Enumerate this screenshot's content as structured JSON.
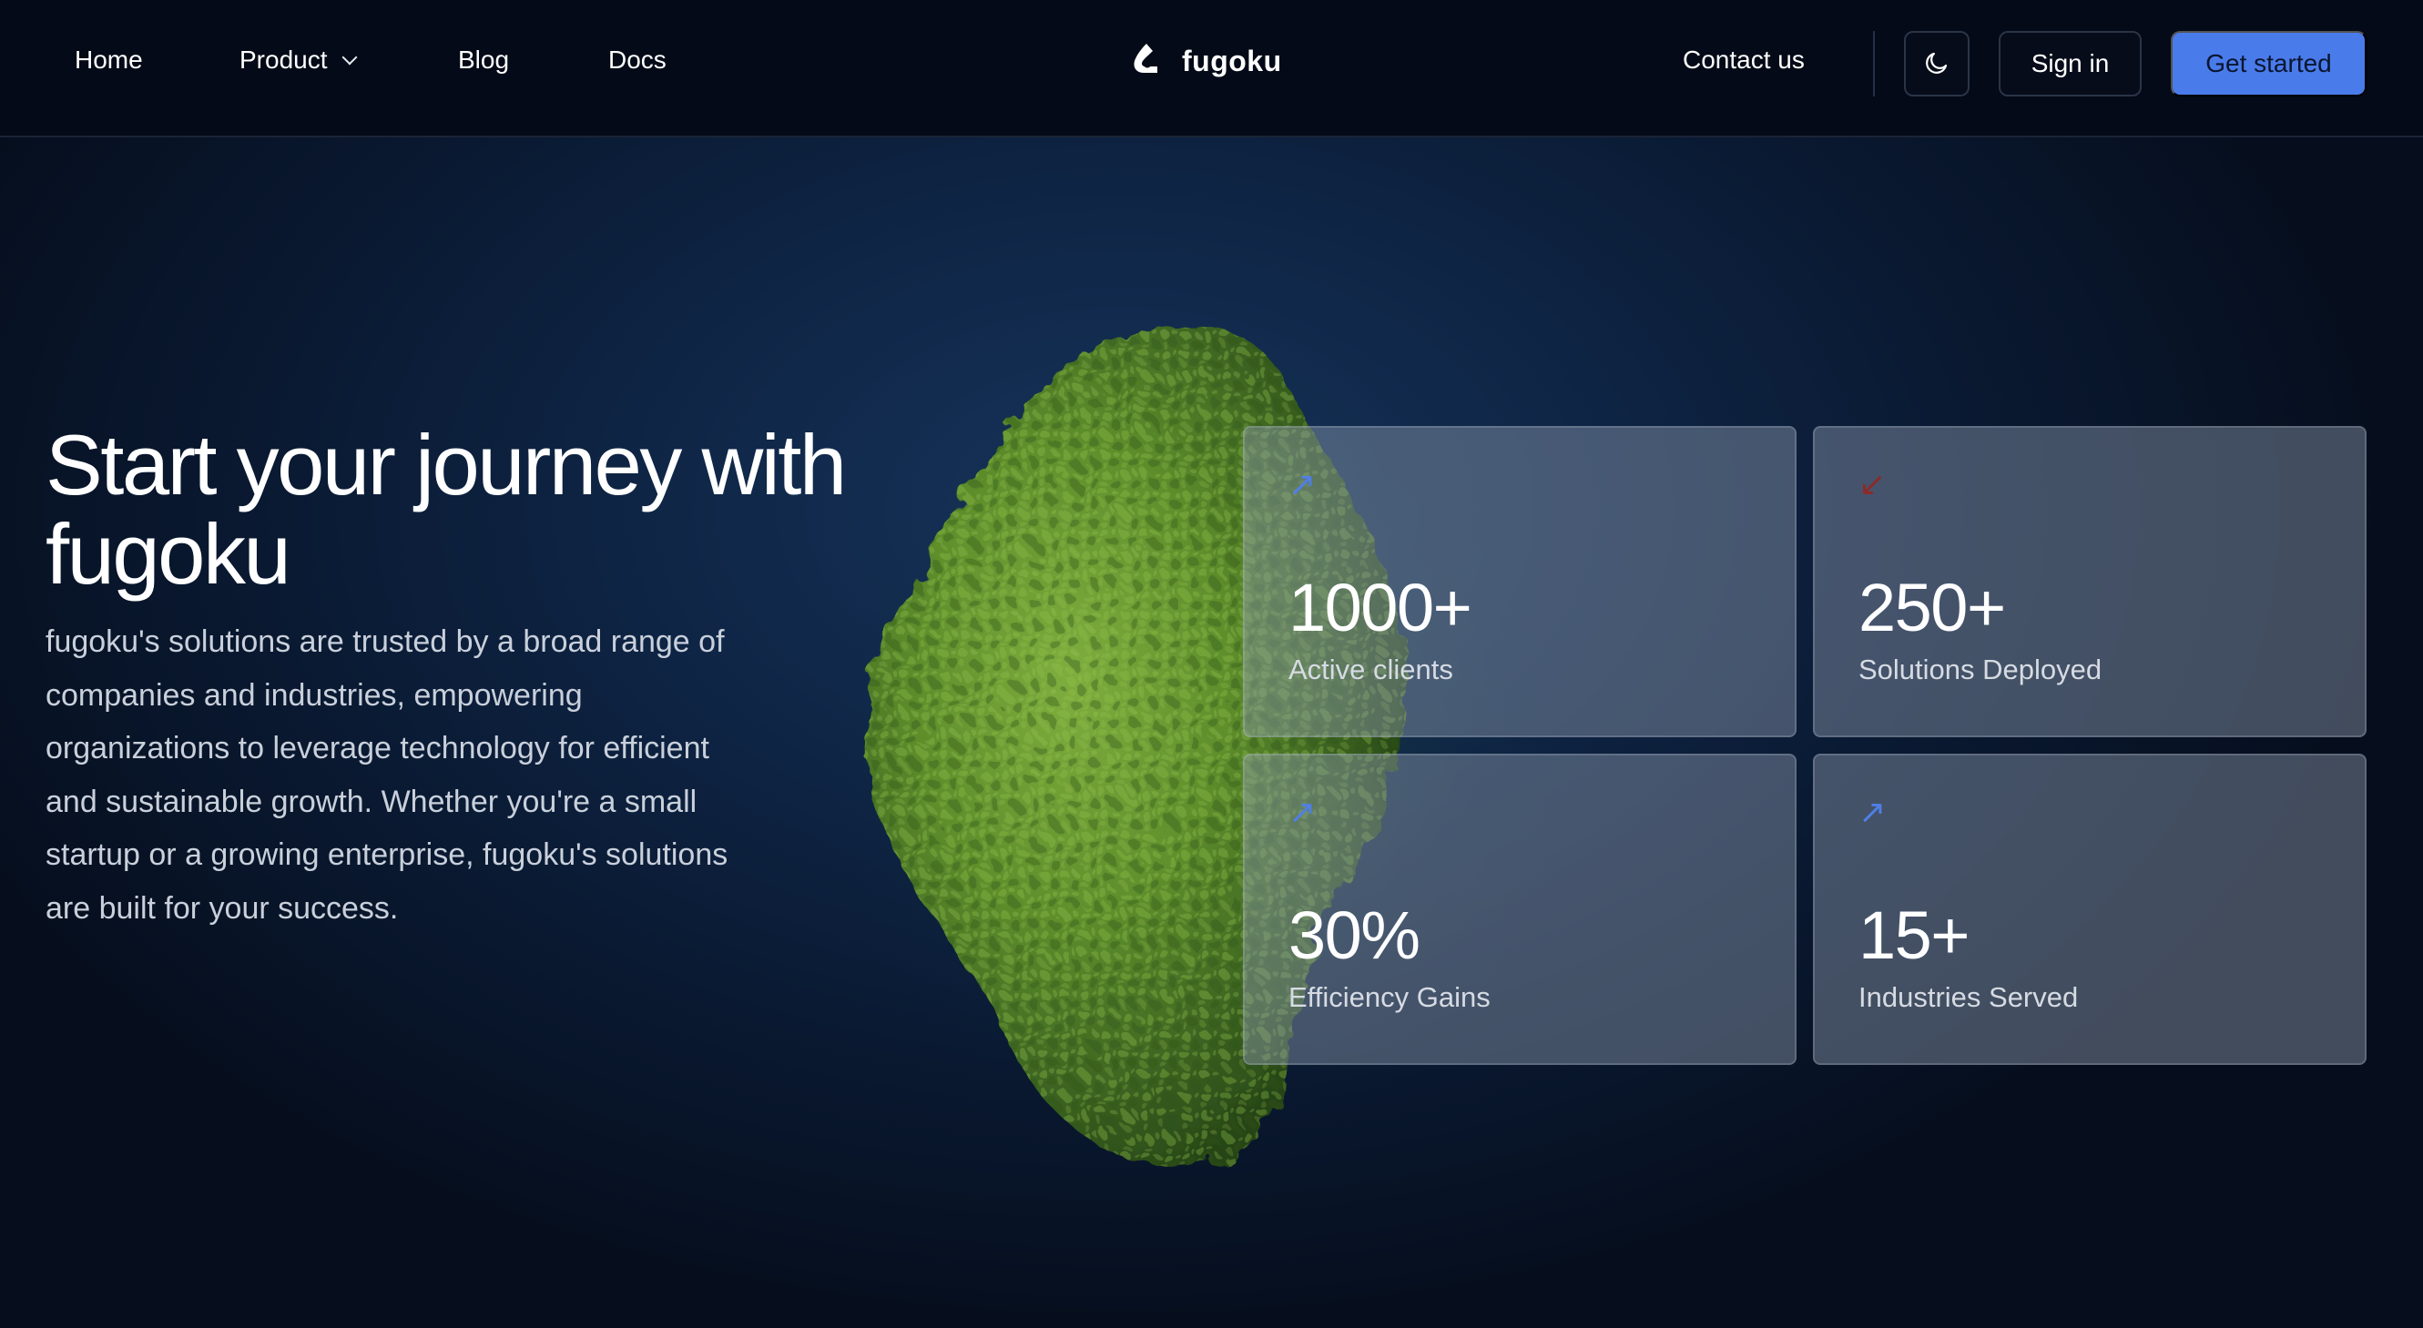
{
  "nav": {
    "home": "Home",
    "product": "Product",
    "blog": "Blog",
    "docs": "Docs",
    "contact": "Contact us",
    "sign_in": "Sign in",
    "get_started": "Get started",
    "theme_toggle_icon": "moon-icon",
    "product_dropdown_icon": "chevron-down-icon"
  },
  "brand": {
    "name": "fugoku",
    "logo_icon": "fugoku-logo-icon"
  },
  "hero": {
    "title": "Start your journey with fugoku",
    "description": "fugoku's solutions are trusted by a broad range of companies and industries, empowering organizations to leverage technology for efficient and sustainable growth. Whether you're a small startup or a growing enterprise, fugoku's solutions are built for your success."
  },
  "stats": [
    {
      "value": "1000+",
      "label": "Active clients",
      "trend": "up",
      "icon": "arrow-up-right-icon"
    },
    {
      "value": "250+",
      "label": "Solutions Deployed",
      "trend": "down",
      "icon": "arrow-down-left-icon"
    },
    {
      "value": "30%",
      "label": "Efficiency Gains",
      "trend": "up",
      "icon": "arrow-up-right-icon"
    },
    {
      "value": "15+",
      "label": "Industries Served",
      "trend": "up",
      "icon": "arrow-up-right-icon"
    }
  ],
  "colors": {
    "header_bg": "#040a17",
    "primary_button": "#4a7bea",
    "trend_up": "#4f7fe6",
    "trend_down": "#8c2a2a",
    "moss_green": "#6d9a35"
  }
}
